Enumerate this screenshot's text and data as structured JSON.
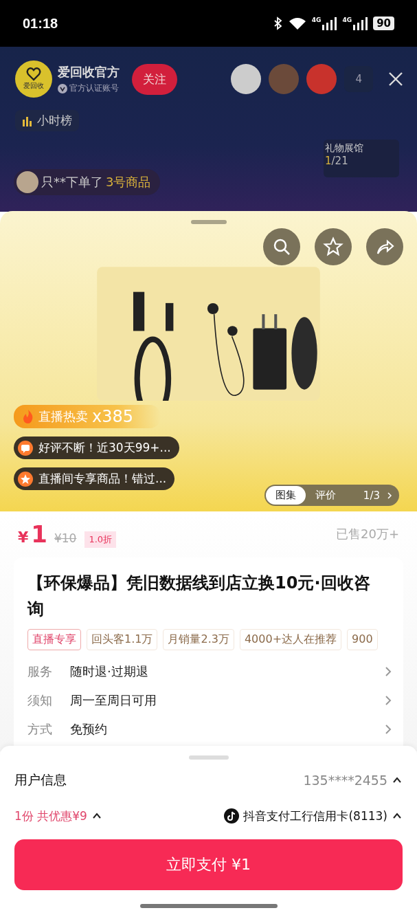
{
  "status_bar": {
    "time": "01:18",
    "network": [
      "4G",
      "4G"
    ],
    "battery": "90"
  },
  "live": {
    "anchor": {
      "name": "爱回收官方",
      "avatar_text": "爱回收",
      "verified": "官方认证账号"
    },
    "follow": "关注",
    "viewer_count": "4",
    "rank": "小时榜",
    "gift": {
      "label": "礼物展馆",
      "current": "1",
      "total": "/21"
    },
    "order_notice": {
      "text": "只**下单了",
      "item": "3号商品"
    }
  },
  "product_media": {
    "hot_label": "直播热卖",
    "hot_count": "x385",
    "highlights": [
      {
        "kind": "review",
        "text": "好评不断！近30天99+..."
      },
      {
        "kind": "exclusive",
        "text": "直播间专享商品！错过..."
      }
    ],
    "tabs": [
      {
        "label": "图集",
        "selected": true
      },
      {
        "label": "评价",
        "selected": false
      }
    ],
    "page": "1/3"
  },
  "price": {
    "currency": "¥",
    "amount": "1",
    "original": "¥10",
    "discount": "1.0折",
    "sold": "已售20万+"
  },
  "title": "【环保爆品】凭旧数据线到店立换10元·回收咨询",
  "tags": [
    {
      "kind": "exclusive",
      "text": "直播专享"
    },
    {
      "kind": "stat",
      "text": "回头客1.1万"
    },
    {
      "kind": "stat",
      "text": "月销量2.3万"
    },
    {
      "kind": "stat",
      "text": "4000+达人在推荐"
    },
    {
      "kind": "stat",
      "text": "900"
    }
  ],
  "info_rows": [
    {
      "label": "服务",
      "value": "随时退·过期退"
    },
    {
      "label": "须知",
      "value": "周一至周日可用"
    },
    {
      "label": "方式",
      "value": "免预约"
    }
  ],
  "checkout": {
    "user_info_label": "用户信息",
    "phone": "135****2455",
    "savings": "1份 共优惠¥9",
    "payment_method": "抖音支付工行信用卡(8113)",
    "pay_button": "立即支付 ¥1"
  }
}
